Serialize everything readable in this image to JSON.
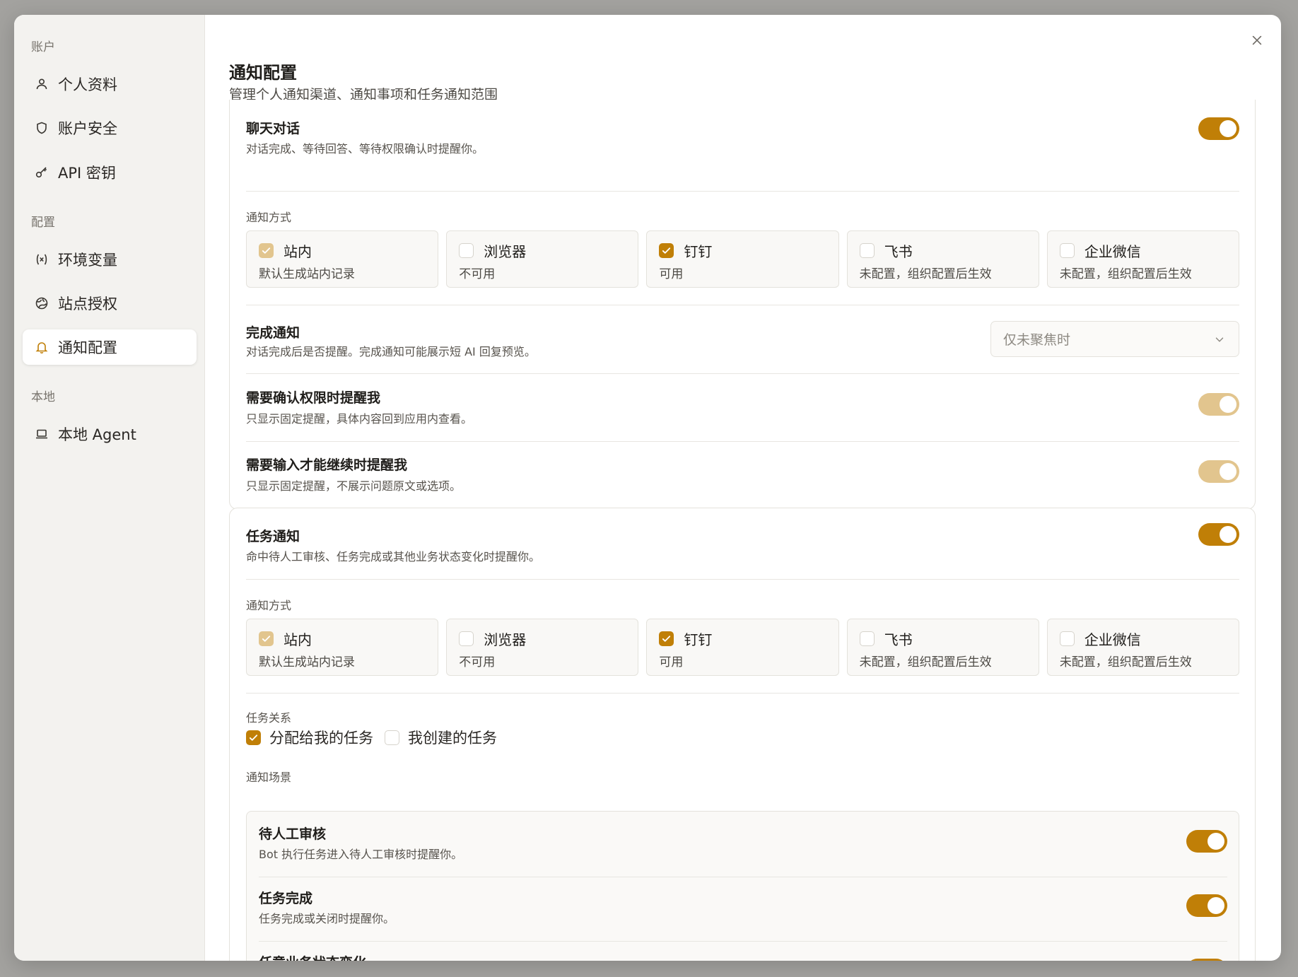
{
  "sidebar": {
    "sections": {
      "account": "账户",
      "config": "配置",
      "local": "本地"
    },
    "items": [
      {
        "label": "个人资料",
        "icon": "user-icon"
      },
      {
        "label": "账户安全",
        "icon": "shield-icon"
      },
      {
        "label": "API 密钥",
        "icon": "key-icon"
      },
      {
        "label": "环境变量",
        "icon": "variable-icon"
      },
      {
        "label": "站点授权",
        "icon": "globe-icon"
      },
      {
        "label": "通知配置",
        "icon": "bell-icon",
        "active": true
      },
      {
        "label": "本地 Agent",
        "icon": "laptop-icon"
      }
    ]
  },
  "header": {
    "title": "通知配置",
    "subtitle": "管理个人通知渠道、通知事项和任务通知范围"
  },
  "chat": {
    "title": "聊天对话",
    "desc": "对话完成、等待回答、等待权限确认时提醒你。",
    "enabled": true,
    "channels_label": "通知方式",
    "channels": [
      {
        "name": "站内",
        "desc": "默认生成站内记录",
        "checked": true,
        "locked": true
      },
      {
        "name": "浏览器",
        "desc": "不可用",
        "checked": false
      },
      {
        "name": "钉钉",
        "desc": "可用",
        "checked": true
      },
      {
        "name": "飞书",
        "desc": "未配置，组织配置后生效",
        "checked": false
      },
      {
        "name": "企业微信",
        "desc": "未配置，组织配置后生效",
        "checked": false
      }
    ],
    "completion": {
      "title": "完成通知",
      "desc": "对话完成后是否提醒。完成通知可能展示短 AI 回复预览。",
      "select_value": "仅未聚焦时"
    },
    "permission": {
      "title": "需要确认权限时提醒我",
      "desc": "只显示固定提醒，具体内容回到应用内查看。",
      "enabled": true
    },
    "input": {
      "title": "需要输入才能继续时提醒我",
      "desc": "只显示固定提醒，不展示问题原文或选项。",
      "enabled": true
    }
  },
  "task": {
    "title": "任务通知",
    "desc": "命中待人工审核、任务完成或其他业务状态变化时提醒你。",
    "enabled": true,
    "channels_label": "通知方式",
    "channels": [
      {
        "name": "站内",
        "desc": "默认生成站内记录",
        "checked": true,
        "locked": true
      },
      {
        "name": "浏览器",
        "desc": "不可用",
        "checked": false
      },
      {
        "name": "钉钉",
        "desc": "可用",
        "checked": true
      },
      {
        "name": "飞书",
        "desc": "未配置，组织配置后生效",
        "checked": false
      },
      {
        "name": "企业微信",
        "desc": "未配置，组织配置后生效",
        "checked": false
      }
    ],
    "relation_label": "任务关系",
    "relations": [
      {
        "label": "分配给我的任务",
        "checked": true
      },
      {
        "label": "我创建的任务",
        "checked": false
      }
    ],
    "scenarios_label": "通知场景",
    "scenarios": [
      {
        "title": "待人工审核",
        "desc": "Bot 执行任务进入待人工审核时提醒你。",
        "enabled": true
      },
      {
        "title": "任务完成",
        "desc": "任务完成或关闭时提醒你。",
        "enabled": true
      },
      {
        "title": "任意业务状态变化",
        "desc": "",
        "enabled": true
      }
    ]
  },
  "colors": {
    "accent": "#c07f07",
    "accent_faded": "#e2c58e",
    "sidebar_bg": "#f3f2ef",
    "overlay": "#a3a29f"
  }
}
